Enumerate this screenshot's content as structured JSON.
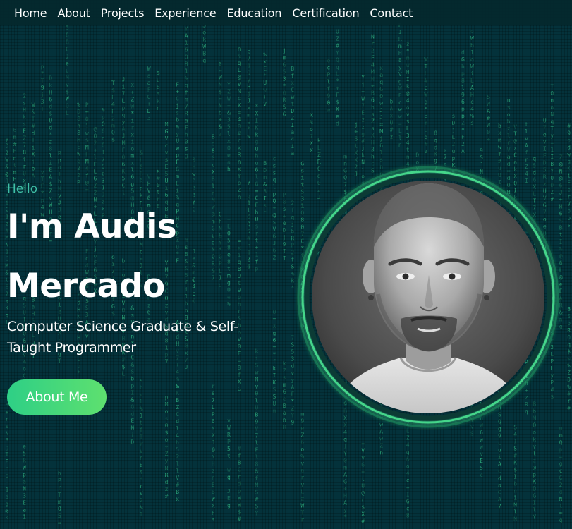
{
  "nav": {
    "items": [
      {
        "label": "Home"
      },
      {
        "label": "About"
      },
      {
        "label": "Projects"
      },
      {
        "label": "Experience"
      },
      {
        "label": "Education"
      },
      {
        "label": "Certification"
      },
      {
        "label": "Contact"
      }
    ]
  },
  "hero": {
    "greeting": "Hello",
    "name_line1": "I'm Audis",
    "name_line2": "Mercado",
    "role": "Computer Science Graduate & Self-Taught Programmer",
    "cta_label": "About Me"
  },
  "colors": {
    "background": "#04323b",
    "accent_green": "#2ecf86",
    "greeting": "#3fbfa6",
    "matrix_glyph": "#35c48a"
  },
  "portrait": {
    "subject": "grayscale illustrated portrait of a man with buzz cut and goatee"
  }
}
